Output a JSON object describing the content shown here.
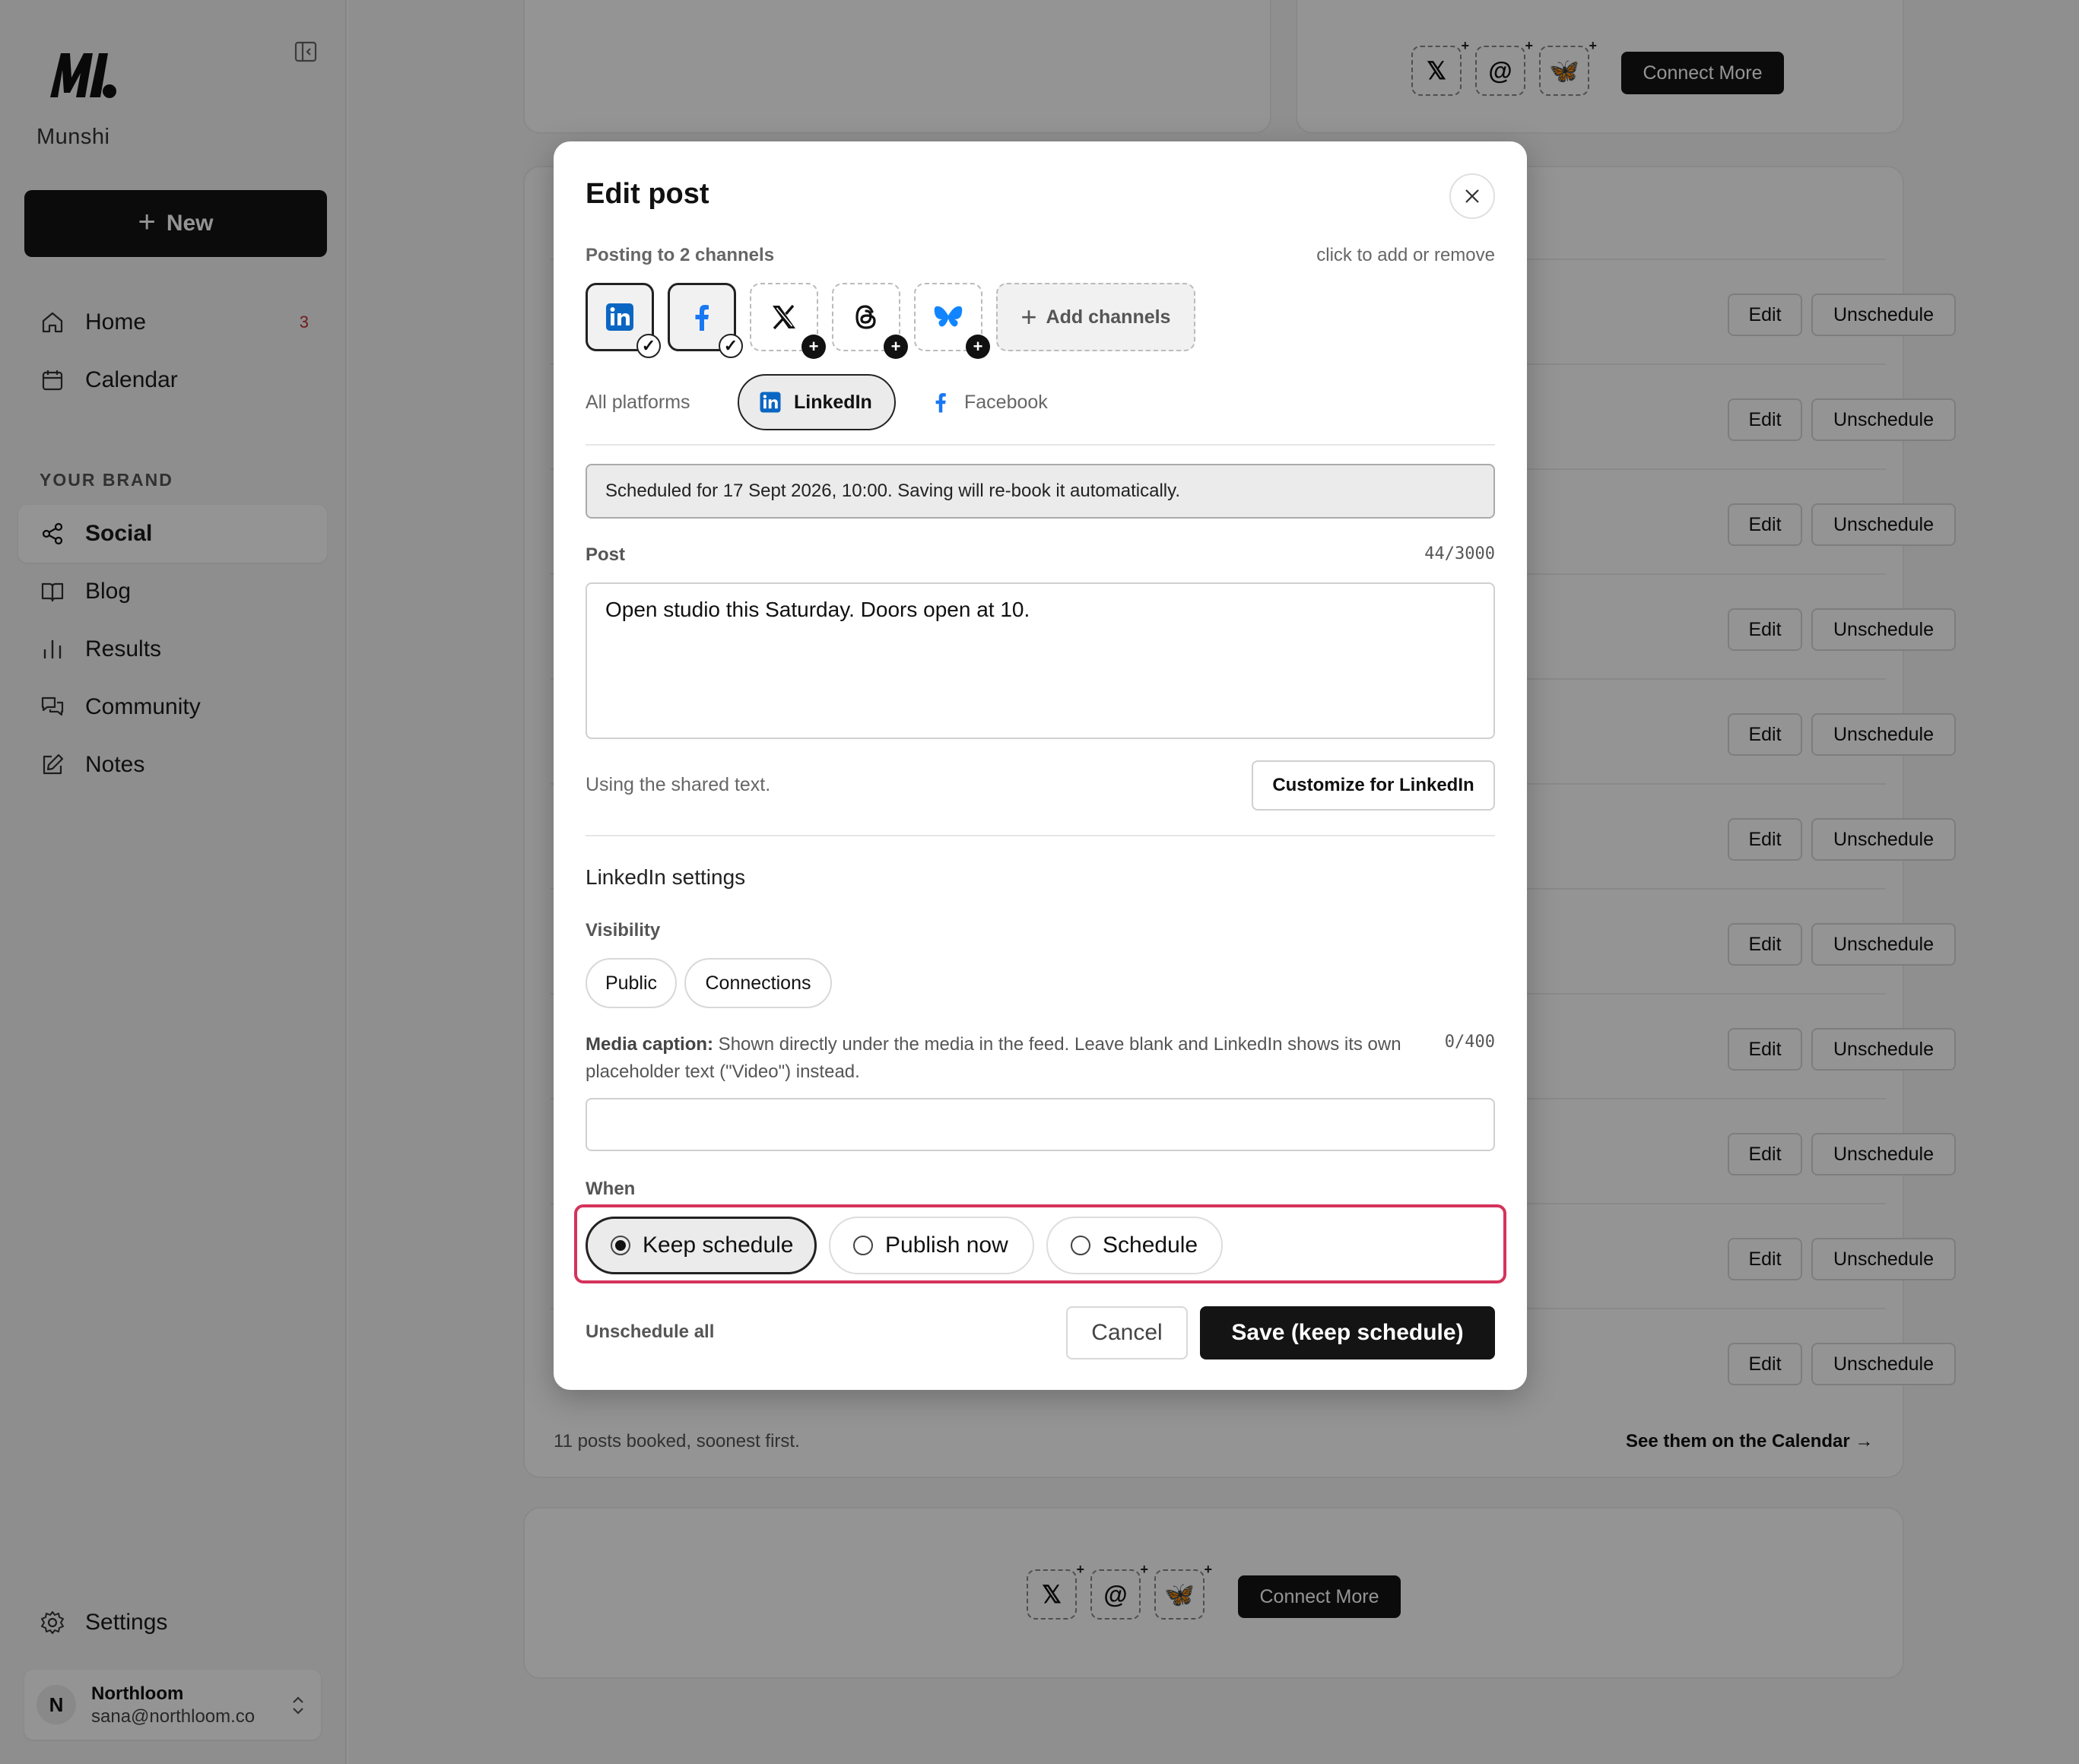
{
  "sidebar": {
    "brand": "Munshi",
    "new_label": "New",
    "nav": [
      {
        "label": "Home",
        "badge": "3"
      },
      {
        "label": "Calendar"
      }
    ],
    "section_label": "YOUR BRAND",
    "brand_nav": [
      {
        "label": "Social"
      },
      {
        "label": "Blog"
      },
      {
        "label": "Results"
      },
      {
        "label": "Community"
      },
      {
        "label": "Notes"
      }
    ],
    "settings_label": "Settings",
    "account": {
      "initial": "N",
      "name": "Northloom",
      "email": "sana@northloom.co"
    }
  },
  "background": {
    "row_edit_label": "Edit",
    "row_unschedule_label": "Unschedule",
    "footer_text": "11 posts booked, soonest first.",
    "footer_link": "See them on the Calendar →",
    "connect_more_label": "Connect More"
  },
  "modal": {
    "title": "Edit post",
    "posting_label": "Posting to 2 channels",
    "click_hint": "click to add or remove",
    "add_channels_label": "Add channels",
    "tabs": [
      {
        "label": "All platforms"
      },
      {
        "label": "LinkedIn"
      },
      {
        "label": "Facebook"
      }
    ],
    "schedule_banner": "Scheduled for 17 Sept 2026, 10:00. Saving will re-book it automatically.",
    "post_label": "Post",
    "post_counter": "44/3000",
    "post_text": "Open studio this Saturday. Doors open at 10.",
    "shared_text_note": "Using the shared text.",
    "customize_label": "Customize for LinkedIn",
    "settings_title": "LinkedIn settings",
    "visibility_label": "Visibility",
    "visibility_options": [
      "Public",
      "Connections"
    ],
    "media_caption_label": "Media caption:",
    "media_caption_help": " Shown directly under the media in the feed. Leave blank and LinkedIn shows its own placeholder text (\"Video\") instead.",
    "media_caption_counter": "0/400",
    "media_caption_value": "",
    "when_label": "When",
    "when_options": [
      {
        "label": "Keep schedule",
        "selected": true
      },
      {
        "label": "Publish now",
        "selected": false
      },
      {
        "label": "Schedule",
        "selected": false
      }
    ],
    "unschedule_all_label": "Unschedule all",
    "cancel_label": "Cancel",
    "save_label": "Save (keep schedule)"
  },
  "colors": {
    "highlight": "#d4335b",
    "linkedin": "#0a66c2",
    "facebook": "#1877f2",
    "bluesky": "#1185fe",
    "primary": "#141414"
  }
}
